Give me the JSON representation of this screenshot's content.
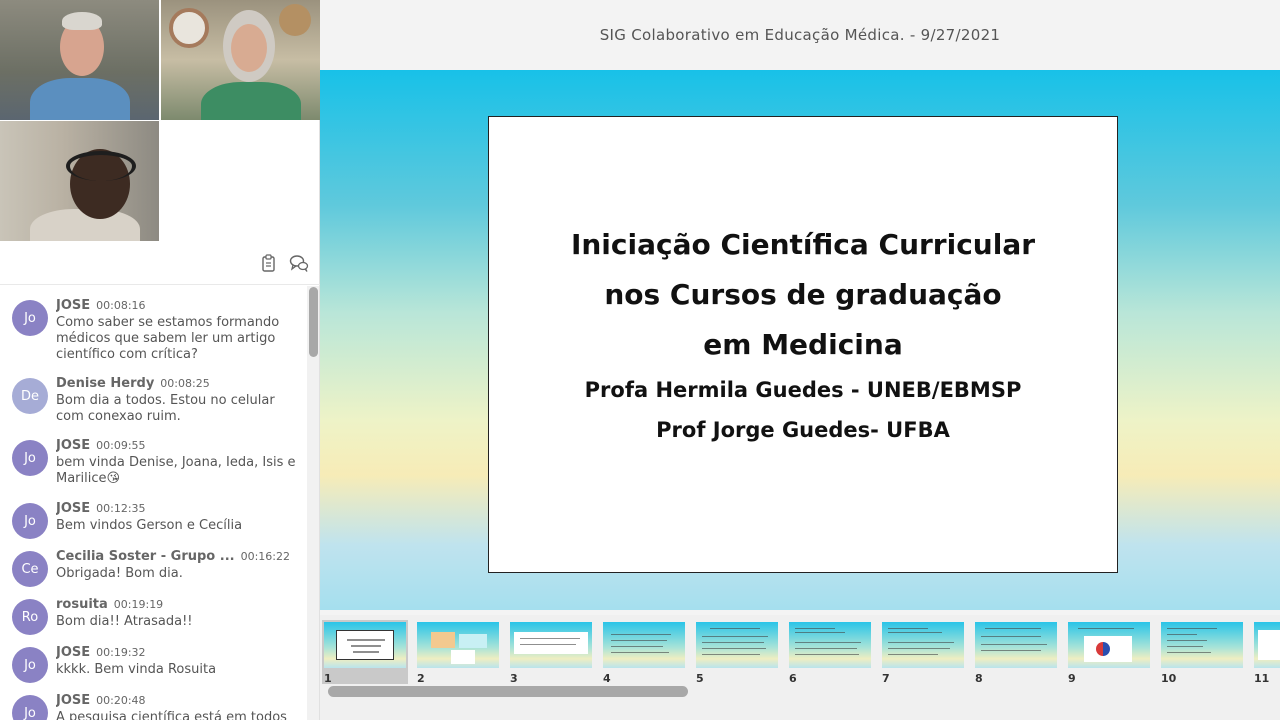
{
  "presentation": {
    "title": "SIG Colaborativo em Educação Médica. - 9/27/2021"
  },
  "slide": {
    "line1": "Iniciação Científica Curricular",
    "line2": "nos Cursos de graduação",
    "line3": "em Medicina",
    "line4": "Profa Hermila Guedes - UNEB/EBMSP",
    "line5": "Prof Jorge Guedes- UFBA"
  },
  "toolbar": {
    "icons": [
      "clipboard-icon",
      "chat-bubbles-icon"
    ]
  },
  "chat": {
    "messages": [
      {
        "initials": "Jo",
        "name": "JOSE",
        "time": "00:08:16",
        "text": "Como saber se estamos formando médicos que sabem ler um artigo científico com crítica?"
      },
      {
        "initials": "De",
        "name": "Denise Herdy",
        "time": "00:08:25",
        "text": "Bom dia a todos. Estou no celular com conexao ruim."
      },
      {
        "initials": "Jo",
        "name": "JOSE",
        "time": "00:09:55",
        "text": "bem vinda Denise, Joana, Ieda, Isis e Marilice😘"
      },
      {
        "initials": "Jo",
        "name": "JOSE",
        "time": "00:12:35",
        "text": "Bem vindos Gerson e Cecília"
      },
      {
        "initials": "Ce",
        "name": "Cecilia Soster - Grupo ...",
        "time": "00:16:22",
        "text": "Obrigada! Bom dia."
      },
      {
        "initials": "Ro",
        "name": "rosuita",
        "time": "00:19:19",
        "text": "Bom dia!! Atrasada!!"
      },
      {
        "initials": "Jo",
        "name": "JOSE",
        "time": "00:19:32",
        "text": "kkkk. Bem vinda Rosuita"
      },
      {
        "initials": "Jo",
        "name": "JOSE",
        "time": "00:20:48",
        "text": "A pesquisa científica está em todos"
      }
    ]
  },
  "thumbnails": [
    "1",
    "2",
    "3",
    "4",
    "5",
    "6",
    "7",
    "8",
    "9",
    "10",
    "11"
  ]
}
